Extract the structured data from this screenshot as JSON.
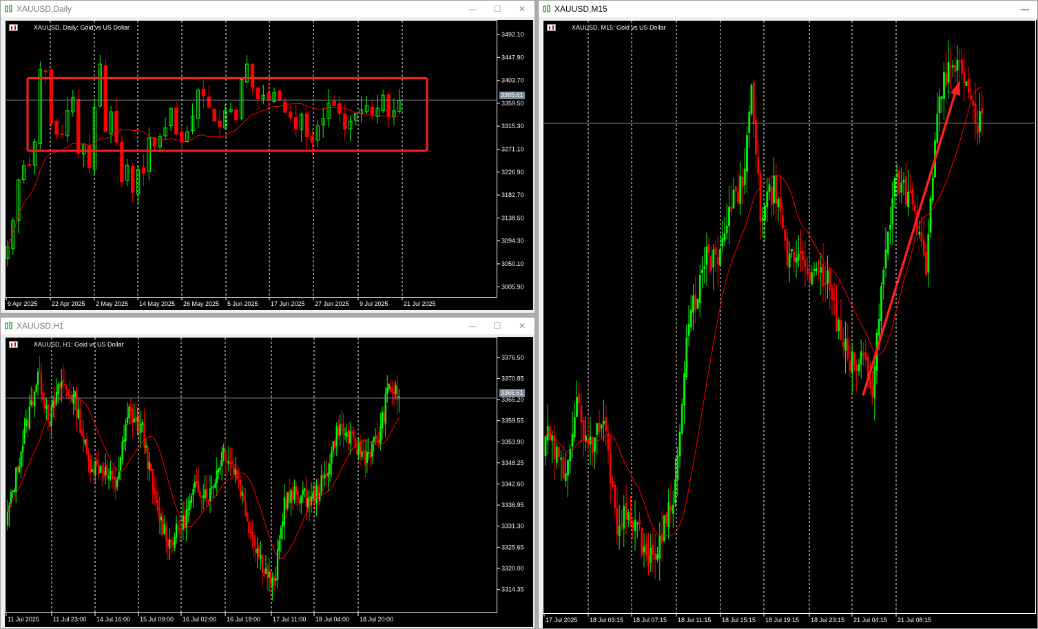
{
  "colors": {
    "bull": "#00ff00",
    "bear": "#ff0000",
    "ma": "#ff0000",
    "grid": "#ffffff",
    "bid": "#7f8b98",
    "annotation": "#ff2020"
  },
  "windows": {
    "daily": {
      "title": "XAUUSD,Daily",
      "header": "XAUUSD, Daily:  Gold vs US Dollar",
      "price_label": "3365.61",
      "y_ticks": [
        "3492.10",
        "3447.90",
        "3403.70",
        "3359.50",
        "3315.30",
        "3271.10",
        "3226.90",
        "3182.70",
        "3138.50",
        "3094.30",
        "3050.10",
        "3005.90"
      ],
      "x_ticks": [
        "9 Apr 2025",
        "22 Apr 2025",
        "2 May 2025",
        "14 May 2025",
        "26 May 2025",
        "5 Jun 2025",
        "17 Jun 2025",
        "27 Jun 2025",
        "9 Jul 2025",
        "21 Jul 2025"
      ]
    },
    "h1": {
      "title": "XAUUSD,H1",
      "header": "XAUUSD, H1:  Gold vs US Dollar",
      "price_label": "3365.61",
      "y_ticks": [
        "3376.50",
        "3370.85",
        "3365.20",
        "3359.55",
        "3353.90",
        "3348.25",
        "3342.60",
        "3336.95",
        "3331.30",
        "3325.65",
        "3320.00",
        "3314.35"
      ],
      "x_ticks": [
        "11 Jul 2025",
        "11 Jul 23:00",
        "14 Jul 16:00",
        "15 Jul 09:00",
        "16 Jul 02:00",
        "16 Jul 18:00",
        "17 Jul 11:00",
        "18 Jul 04:00",
        "18 Jul 20:00"
      ]
    },
    "m15": {
      "title": "XAUUSD,M15",
      "header": "XAUUSD, M15:  Gold vs US Dollar",
      "x_ticks": [
        "17 Jul 2025",
        "18 Jul 03:15",
        "18 Jul 07:15",
        "18 Jul 11:15",
        "18 Jul 15:15",
        "18 Jul 19:15",
        "18 Jul 23:15",
        "21 Jul 04:15",
        "21 Jul 08:15"
      ]
    }
  },
  "icons": {
    "title": "chart-window-icon",
    "header_grid": "grid-icon",
    "header_bars": "bars-icon"
  },
  "chart_data": [
    {
      "type": "candlestick",
      "title": "XAUUSD, Daily:  Gold vs US Dollar",
      "xlabel": "",
      "ylabel": "",
      "ylim": [
        2985,
        3520
      ],
      "x_ticks": [
        "9 Apr 2025",
        "22 Apr 2025",
        "2 May 2025",
        "14 May 2025",
        "26 May 2025",
        "5 Jun 2025",
        "17 Jun 2025",
        "27 Jun 2025",
        "9 Jul 2025",
        "21 Jul 2025"
      ],
      "last_price": 3365.61,
      "annotation": "red rectangle consolidation box from approx 3271 to 3403",
      "series": [
        {
          "name": "close",
          "values": [
            3083,
            3133,
            3212,
            3239,
            3240,
            3285,
            3425,
            3420,
            3321,
            3300,
            3300,
            3345,
            3370,
            3263,
            3281,
            3235,
            3352,
            3435,
            3305,
            3343,
            3285,
            3208,
            3240,
            3188,
            3232,
            3225,
            3293,
            3277,
            3295,
            3312,
            3350,
            3300,
            3285,
            3304,
            3335,
            3385,
            3374,
            3352,
            3325,
            3315,
            3345,
            3348,
            3328,
            3405,
            3435,
            3390,
            3368,
            3375,
            3365,
            3380,
            3365,
            3342,
            3332,
            3310,
            3338,
            3295,
            3285,
            3316,
            3330,
            3360,
            3355,
            3340,
            3310,
            3325,
            3340,
            3347,
            3355,
            3338,
            3350,
            3375,
            3335,
            3345,
            3365
          ]
        }
      ]
    },
    {
      "type": "candlestick",
      "title": "XAUUSD, H1:  Gold vs US Dollar",
      "xlabel": "",
      "ylabel": "",
      "ylim": [
        3308,
        3382
      ],
      "x_ticks": [
        "11 Jul 2025",
        "11 Jul 23:00",
        "14 Jul 16:00",
        "15 Jul 09:00",
        "16 Jul 02:00",
        "16 Jul 18:00",
        "17 Jul 11:00",
        "18 Jul 04:00",
        "18 Jul 20:00"
      ],
      "last_price": 3365.61
    },
    {
      "type": "candlestick",
      "title": "XAUUSD, M15:  Gold vs US Dollar",
      "xlabel": "",
      "ylabel": "",
      "x_ticks": [
        "17 Jul 2025",
        "18 Jul 03:15",
        "18 Jul 07:15",
        "18 Jul 11:15",
        "18 Jul 15:15",
        "18 Jul 19:15",
        "18 Jul 23:15",
        "21 Jul 04:15",
        "21 Jul 08:15"
      ],
      "annotation": "red upward arrow drawn from lower right rising to top"
    }
  ]
}
